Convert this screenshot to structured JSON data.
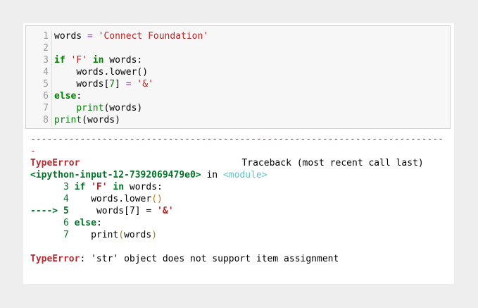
{
  "code_cell": {
    "line_numbers": [
      "1",
      "2",
      "3",
      "4",
      "5",
      "6",
      "7",
      "8"
    ],
    "lines": {
      "l1": {
        "var": "words",
        "op": "=",
        "str": "'Connect Foundation'"
      },
      "l3": {
        "kw_if": "if",
        "str": "'F'",
        "kw_in": "in",
        "rest": "words:"
      },
      "l4": {
        "indent": "    ",
        "text": "words.lower()"
      },
      "l5": {
        "indent": "    ",
        "target": "words[",
        "index": "7",
        "close": "]",
        "op": "=",
        "str": "'&'"
      },
      "l6": {
        "kw_else": "else",
        "colon": ":"
      },
      "l7": {
        "indent": "    ",
        "builtin": "print",
        "args": "(words)"
      },
      "l8": {
        "builtin": "print",
        "args": "(words)"
      }
    }
  },
  "output": {
    "separator": "---------------------------------------------------------------------------",
    "separator_tail": "-",
    "error_name": "TypeError",
    "traceback_header": "Traceback (most recent call last)",
    "input_ref": "<ipython-input-12-7392069479e0>",
    "in_word": "in",
    "module_ref": "<module>",
    "tb_lines": {
      "t3": {
        "num": "3",
        "kw_if": "if",
        "str": "'F'",
        "kw_in": "in",
        "rest": "words:"
      },
      "t4": {
        "num": "4",
        "text": "words.lower",
        "parens": "()"
      },
      "t5": {
        "arrow": "---->",
        "num": "5",
        "target": "words[7]",
        "op": "=",
        "str": "'&'"
      },
      "t6": {
        "num": "6",
        "kw_else": "else",
        "colon": ":"
      },
      "t7": {
        "num": "7",
        "builtin": "print",
        "open": "(",
        "arg": "words",
        "close": ")"
      }
    },
    "final_error_name": "TypeError",
    "final_message": ": 'str' object does not support item assignment"
  }
}
